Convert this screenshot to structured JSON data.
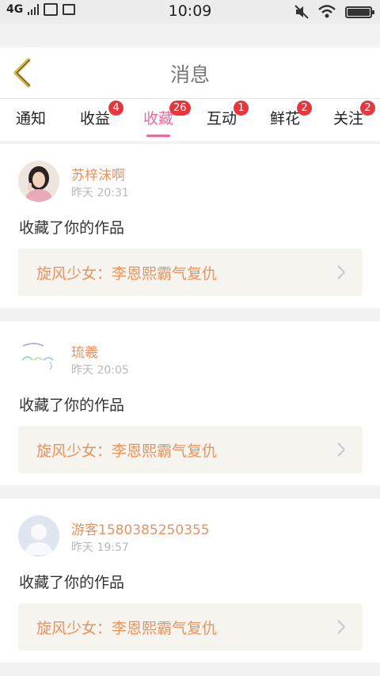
{
  "status_bar": {
    "time": "10:09",
    "network": "4G"
  },
  "header": {
    "title": "消息"
  },
  "tabs": [
    {
      "label": "通知"
    },
    {
      "label": "收益",
      "badge": "4"
    },
    {
      "label": "收藏",
      "badge": "26",
      "active": true
    },
    {
      "label": "互动",
      "badge": "1"
    },
    {
      "label": "鲜花",
      "badge": "2"
    },
    {
      "label": "关注",
      "badge": "2"
    }
  ],
  "messages": [
    {
      "username": "苏梓沫啊",
      "time": "昨天 20:31",
      "action": "收藏了你的作品",
      "work_title": "旋风少女：李恩熙霸气复仇",
      "avatar": "photo-avatar"
    },
    {
      "username": "琉羲",
      "time": "昨天 20:05",
      "action": "收藏了你的作品",
      "work_title": "旋风少女：李恩熙霸气复仇",
      "avatar": "text-art-avatar"
    },
    {
      "username": "游客1580385250355",
      "time": "昨天 19:57",
      "action": "收藏了你的作品",
      "work_title": "旋风少女：李恩熙霸气复仇",
      "avatar": "default-avatar"
    }
  ],
  "colors": {
    "accent": "#e66aa0",
    "name_orange": "#e7935e",
    "badge_red": "#e8373c",
    "back_yellow": "#d8b93a"
  }
}
